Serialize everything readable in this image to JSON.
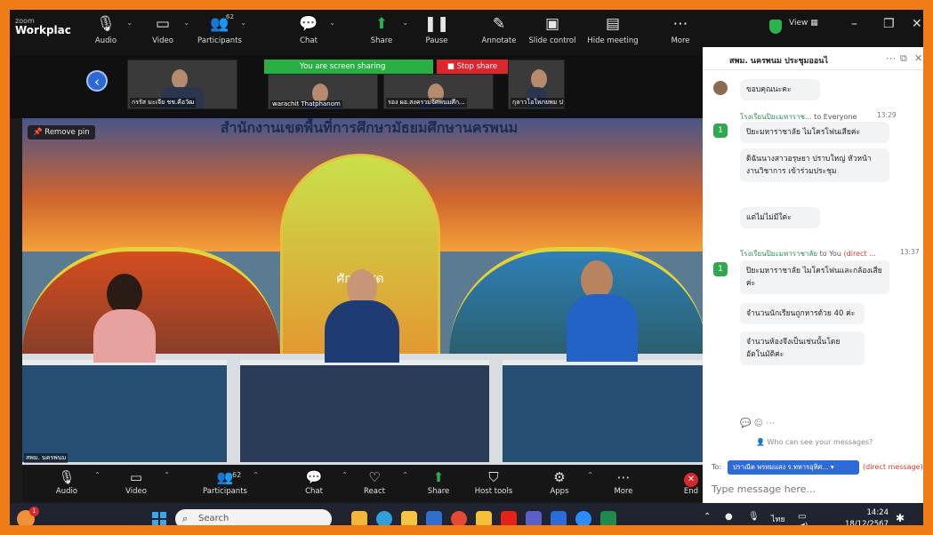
{
  "app": {
    "name_small": "zoom",
    "name": "Workplac"
  },
  "toolbar": [
    {
      "key": "audio",
      "label": "Audio",
      "icon": "microphone-icon",
      "glyph": "🎙",
      "caret": true
    },
    {
      "key": "video",
      "label": "Video",
      "icon": "video-camera-icon",
      "glyph": "▭",
      "caret": true
    },
    {
      "key": "participants",
      "label": "Participants",
      "icon": "participants-icon",
      "glyph": "👥",
      "caret": true,
      "count": "62"
    },
    {
      "key": "chat",
      "label": "Chat",
      "icon": "chat-icon",
      "glyph": "💬",
      "caret": true
    },
    {
      "key": "share",
      "label": "Share",
      "icon": "share-screen-icon",
      "glyph": "⬆",
      "caret": true
    },
    {
      "key": "pause",
      "label": "Pause",
      "icon": "pause-icon",
      "glyph": "❚❚",
      "caret": false
    },
    {
      "key": "annotate",
      "label": "Annotate",
      "icon": "annotate-pen-icon",
      "glyph": "✎",
      "caret": false
    },
    {
      "key": "slide",
      "label": "Slide control",
      "icon": "slide-control-icon",
      "glyph": "▣",
      "caret": false
    },
    {
      "key": "hide",
      "label": "Hide meeting",
      "icon": "hide-meeting-icon",
      "glyph": "▤",
      "caret": false
    },
    {
      "key": "more",
      "label": "More",
      "icon": "more-icon",
      "glyph": "⋯",
      "caret": false
    }
  ],
  "window": {
    "view_label": "View"
  },
  "share_bar": {
    "status": "You are screen sharing",
    "stop_label": "Stop share"
  },
  "thumbnails": [
    {
      "name": "กรรัส มะเจีย ชช.คือวัฒ"
    },
    {
      "name": "warachit Thatphanom"
    },
    {
      "name": "รอง ผอ.สงครวมจ้ศพนมศึก..."
    },
    {
      "name": "กุลาวโอใหภยพม ปาวิยะศ ศ..."
    }
  ],
  "video": {
    "remove_pin": "Remove pin",
    "banner": "สำนักงานเขตพื้นที่การศึกษามัธยมศึกษานครพนม",
    "arch_text": "ศักดิ์ที่สุด",
    "cam_label": "สพม. นครพนม"
  },
  "controls": [
    {
      "key": "audio",
      "label": "Audio",
      "icon": "microphone-icon",
      "glyph": "🎙",
      "caret": true
    },
    {
      "key": "video",
      "label": "Video",
      "icon": "video-camera-icon",
      "glyph": "▭",
      "caret": true
    },
    {
      "key": "participants",
      "label": "Participants",
      "icon": "participants-icon",
      "glyph": "👥",
      "caret": true,
      "count": "62"
    },
    {
      "key": "chat",
      "label": "Chat",
      "icon": "chat-icon",
      "glyph": "💬",
      "caret": true
    },
    {
      "key": "react",
      "label": "React",
      "icon": "heart-react-icon",
      "glyph": "♡",
      "caret": true
    },
    {
      "key": "share",
      "label": "Share",
      "icon": "share-screen-icon",
      "glyph": "⬆",
      "caret": false
    },
    {
      "key": "hosttools",
      "label": "Host tools",
      "icon": "shield-host-icon",
      "glyph": "⛉",
      "caret": false
    },
    {
      "key": "apps",
      "label": "Apps",
      "icon": "apps-icon",
      "glyph": "⚙",
      "caret": true
    },
    {
      "key": "more",
      "label": "More",
      "icon": "more-icon",
      "glyph": "⋯",
      "caret": false
    },
    {
      "key": "end",
      "label": "End",
      "icon": "end-call-icon",
      "glyph": "✕",
      "caret": false
    }
  ],
  "chat": {
    "title": "สพม. นครพนม ประชุมออนไ",
    "top_msg": "ขอบคุณนะคะ",
    "sender1": {
      "name": "โรงเรียนปิยะมหาราช...",
      "to": " to Everyone",
      "time": "13:29"
    },
    "msgs1": [
      "ปิยะมหาราชาลัย ไมโครโฟนเสียค่ะ",
      "ดิฉันนางสาวอรุษยา ปราบใหญ่ หัวหน้างานวิชาการ เข้าร่วมประชุม",
      "แต่ไม่ไม่มีใค่ะ"
    ],
    "sender2": {
      "name": "โรงเรียนปิยะมหาราชาลัย",
      "to": " to You",
      "dm": " (direct ...",
      "time": "13:37"
    },
    "msgs2": [
      "ปิยะมหาราชาลัย ไมโครโฟนและกล้องเสียค่ะ",
      "จำนวนนักเรียนถูกหารด้วย 40 ค่ะ",
      "จำนวนห้องจึงเป็นเช่นนั้นโดยอัตโนมัติค่ะ"
    ],
    "who_see": "Who can see your messages?",
    "to_label": "To:",
    "to_value": "ปราณีต พรหมแสง ร.ทหารอุทิศ...",
    "to_direct": "(direct message)",
    "placeholder": "Type message here..."
  },
  "taskbar": {
    "search_placeholder": "Search",
    "lang": "ไทย",
    "time": "14:24",
    "date": "18/12/2567",
    "weather_badge": "1"
  }
}
